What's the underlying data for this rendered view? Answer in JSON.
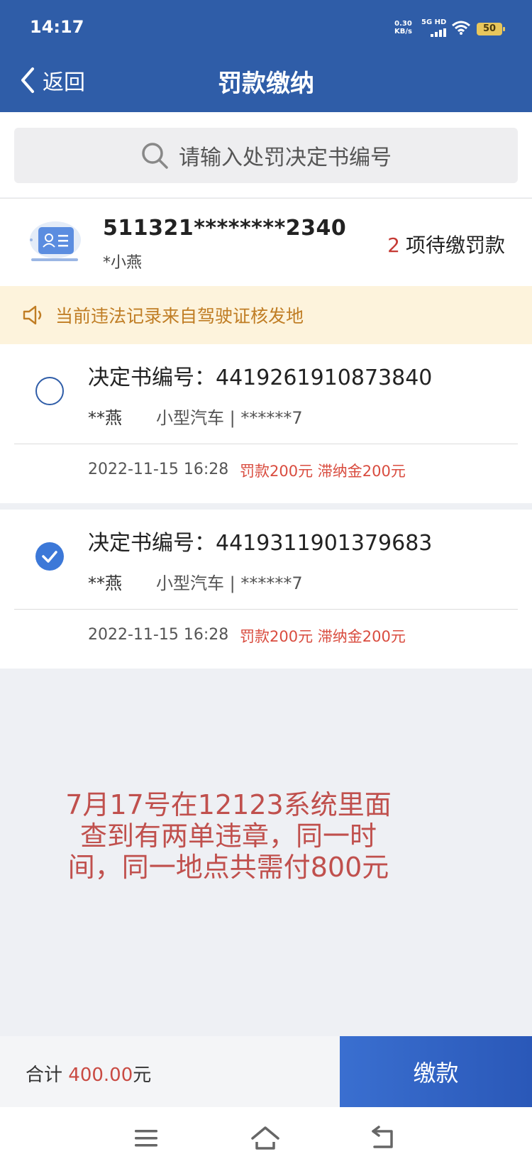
{
  "status_bar": {
    "time": "14:17",
    "speed_value": "0.30",
    "speed_unit": "KB/s",
    "network": "5G HD",
    "battery": "50"
  },
  "nav": {
    "back_label": "返回",
    "title": "罚款缴纳"
  },
  "search": {
    "placeholder": "请输入处罚决定书编号"
  },
  "person": {
    "id_number": "511321********2340",
    "name": "*小燕",
    "pending_count": "2",
    "pending_label": "项待缴罚款"
  },
  "notice": {
    "text": "当前违法记录来自驾驶证核发地"
  },
  "records": [
    {
      "decision_label": "决定书编号：4419261910873840",
      "owner": "**燕",
      "vehicle": "小型汽车 | ******7",
      "datetime": "2022-11-15 16:28",
      "fees": "罚款200元 滞纳金200元",
      "selected": false
    },
    {
      "decision_label": "决定书编号：4419311901379683",
      "owner": "**燕",
      "vehicle": "小型汽车 | ******7",
      "datetime": "2022-11-15 16:28",
      "fees": "罚款200元 滞纳金200元",
      "selected": true
    }
  ],
  "annotation": {
    "line1": "7月17号在12123系统里面",
    "line2": "查到有两单违章，同一时",
    "line3": "间，同一地点共需付800元"
  },
  "footer": {
    "total_label": "合计",
    "total_amount": "400.00",
    "total_unit": "元",
    "pay_button": "缴款"
  },
  "colors": {
    "header_blue": "#2f5da8",
    "accent_red": "#c53a34",
    "notice_bg": "#fdf3dc",
    "notice_text": "#c07d24"
  },
  "icons": {
    "back": "chevron-left-icon",
    "search": "search-icon",
    "id_card": "id-card-icon",
    "notice": "speaker-icon",
    "checked": "check-icon"
  }
}
